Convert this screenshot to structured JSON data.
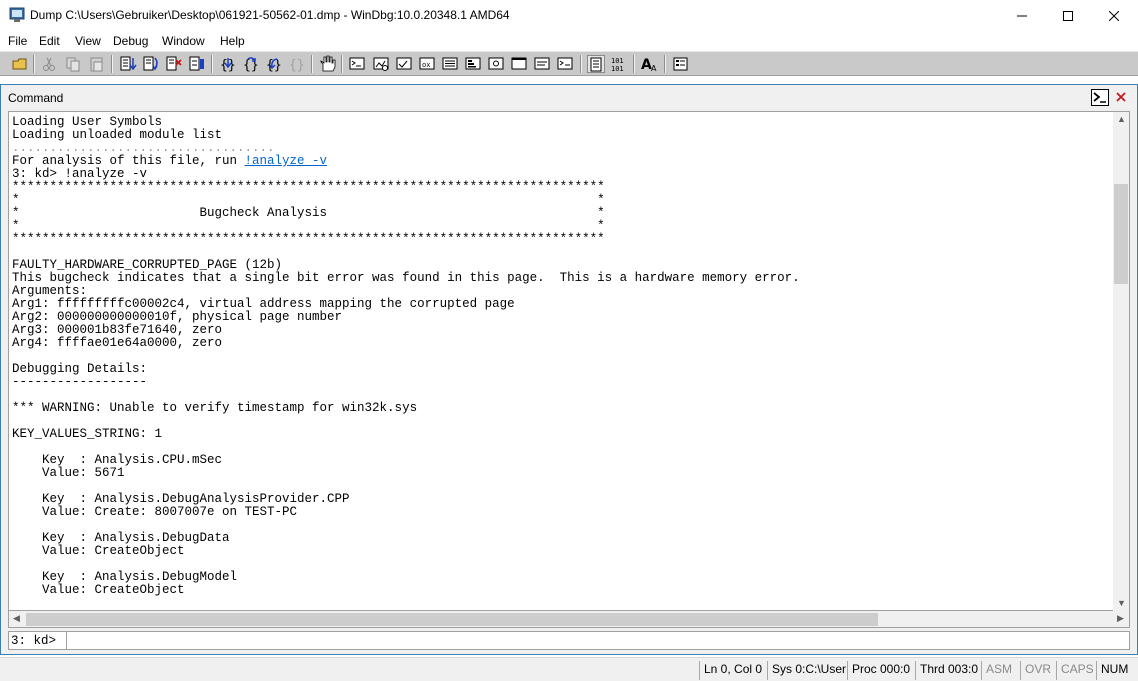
{
  "window": {
    "title": "Dump C:\\Users\\Gebruiker\\Desktop\\061921-50562-01.dmp - WinDbg:10.0.20348.1 AMD64"
  },
  "menu": {
    "items": [
      {
        "label": "File"
      },
      {
        "label": "Edit"
      },
      {
        "label": "View"
      },
      {
        "label": "Debug"
      },
      {
        "label": "Window"
      },
      {
        "label": "Help"
      }
    ]
  },
  "command_window": {
    "title": "Command",
    "prompt": "3: kd>",
    "input_value": "",
    "output": [
      "Loading User Symbols",
      "Loading unloaded module list",
      "...................................",
      "For analysis of this file, run ",
      "3: kd> !analyze -v",
      "*******************************************************************************",
      "*                                                                             *",
      "*                        Bugcheck Analysis                                    *",
      "*                                                                             *",
      "*******************************************************************************",
      "",
      "FAULTY_HARDWARE_CORRUPTED_PAGE (12b)",
      "This bugcheck indicates that a single bit error was found in this page.  This is a hardware memory error.",
      "Arguments:",
      "Arg1: fffffffffc00002c4, virtual address mapping the corrupted page",
      "Arg2: 000000000000010f, physical page number",
      "Arg3: 000001b83fe71640, zero",
      "Arg4: ffffae01e64a0000, zero",
      "",
      "Debugging Details:",
      "------------------",
      "",
      "*** WARNING: Unable to verify timestamp for win32k.sys",
      "",
      "KEY_VALUES_STRING: 1",
      "",
      "    Key  : Analysis.CPU.mSec",
      "    Value: 5671",
      "",
      "    Key  : Analysis.DebugAnalysisProvider.CPP",
      "    Value: Create: 8007007e on TEST-PC",
      "",
      "    Key  : Analysis.DebugData",
      "    Value: CreateObject",
      "",
      "    Key  : Analysis.DebugModel",
      "    Value: CreateObject",
      ""
    ],
    "analyze_link": "!analyze -v"
  },
  "status": {
    "position": "Ln 0, Col 0",
    "sys": "Sys 0:C:\\User",
    "proc": "Proc 000:0",
    "thrd": "Thrd 003:0",
    "asm": "ASM",
    "ovr": "OVR",
    "caps": "CAPS",
    "num": "NUM"
  },
  "icons": {
    "toolbar": [
      "open-icon",
      "cut-icon",
      "copy-icon",
      "paste-icon",
      "step-into-icon",
      "step-over-icon",
      "step-out-icon",
      "run-to-cursor-icon",
      "go-icon",
      "restart-icon",
      "break-icon",
      "stop-icon",
      "hand-icon",
      "command-window-icon",
      "watch-window-icon",
      "locals-window-icon",
      "registers-window-icon",
      "memory-window-icon",
      "call-stack-icon",
      "disassembly-window-icon",
      "scratch-pad-icon",
      "processes-threads-icon",
      "source-mode-icon",
      "binary-icon",
      "font-icon",
      "options-icon"
    ]
  }
}
